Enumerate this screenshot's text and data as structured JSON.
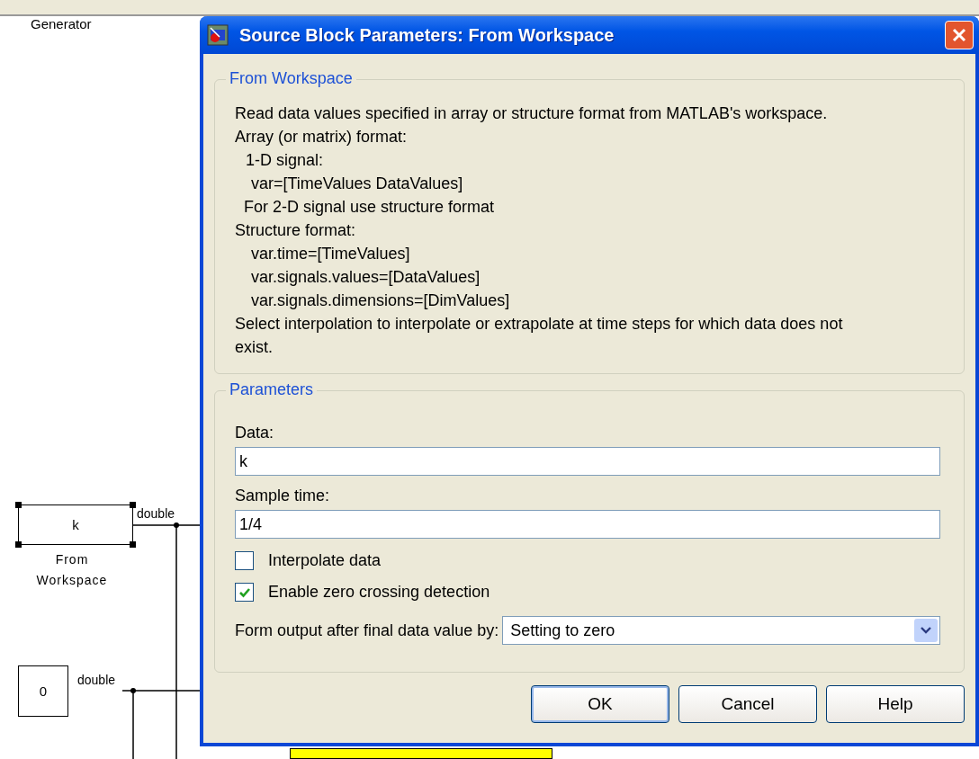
{
  "diagram": {
    "top_label": "Generator",
    "blocks": [
      {
        "kind": "workspace",
        "text": "k",
        "caption": "From Workspace",
        "selected": true,
        "signal": "double"
      },
      {
        "kind": "constant",
        "text": "0",
        "selected": false,
        "signal": "double"
      }
    ]
  },
  "dialog": {
    "title": "Source Block Parameters: From Workspace",
    "description": {
      "title": "From Workspace",
      "lines": [
        {
          "kind": "plain",
          "text": "Read data values specified in array or structure format from MATLAB's workspace."
        },
        {
          "kind": "plain",
          "text": "Array (or matrix) format:"
        },
        {
          "kind": "item",
          "text": "1-D signal:"
        },
        {
          "kind": "detail",
          "text": "var=[TimeValues DataValues]"
        },
        {
          "kind": "note",
          "text": "For 2-D signal use structure format"
        },
        {
          "kind": "plain",
          "text": "Structure format:"
        },
        {
          "kind": "detail",
          "text": "var.time=[TimeValues]"
        },
        {
          "kind": "detail",
          "text": "var.signals.values=[DataValues]"
        },
        {
          "kind": "detail",
          "text": "var.signals.dimensions=[DimValues]"
        },
        {
          "kind": "plain",
          "text": "Select interpolation to interpolate or extrapolate at time steps for which data does not exist."
        }
      ]
    },
    "parameters": {
      "title": "Parameters",
      "items": [
        {
          "kind": "field",
          "label": "Data:",
          "value": "k"
        },
        {
          "kind": "field",
          "label": "Sample time:",
          "value": "1/4"
        },
        {
          "kind": "checkbox",
          "label": "Interpolate data",
          "checked": false
        },
        {
          "kind": "checkbox",
          "label": "Enable zero crossing detection",
          "checked": true
        },
        {
          "kind": "dropdown",
          "label": "Form output after final data value by:",
          "value": "Setting to zero"
        }
      ]
    },
    "buttons": [
      {
        "label": "OK",
        "default": true
      },
      {
        "label": "Cancel",
        "default": false
      },
      {
        "label": "Help",
        "default": false
      }
    ]
  }
}
